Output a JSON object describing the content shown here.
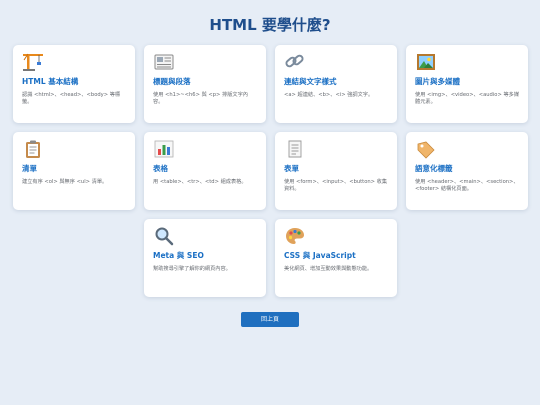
{
  "page": {
    "title": "HTML 要學什麼?"
  },
  "cards": [
    {
      "icon": "construction-crane-icon",
      "title": "HTML 基本結構",
      "desc": "認識 <html>、<head>、<body> 等標籤。"
    },
    {
      "icon": "newspaper-icon",
      "title": "標題與段落",
      "desc": "使用 <h1>~<h6> 與 <p> 排版文字內容。"
    },
    {
      "icon": "link-icon",
      "title": "連結與文字樣式",
      "desc": "<a> 超連結、<b>、<i> 強調文字。"
    },
    {
      "icon": "framed-picture-icon",
      "title": "圖片與多媒體",
      "desc": "使用 <img>、<video>、<audio> 等多媒體元素。"
    },
    {
      "icon": "clipboard-icon",
      "title": "清單",
      "desc": "建立有序 <ol> 與無序 <ul> 清單。"
    },
    {
      "icon": "bar-chart-icon",
      "title": "表格",
      "desc": "用 <table>、<tr>、<td> 組成表格。"
    },
    {
      "icon": "form-document-icon",
      "title": "表單",
      "desc": "使用 <form>、<input>、<button> 收集資料。"
    },
    {
      "icon": "tag-icon",
      "title": "語意化標籤",
      "desc": "使用 <header>、<main>、<section>、<footer> 結構化頁面。"
    },
    {
      "icon": "magnifying-glass-icon",
      "title": "Meta 與 SEO",
      "desc": "幫助搜尋引擎了解你的網頁內容。"
    },
    {
      "icon": "artist-palette-icon",
      "title": "CSS 與 JavaScript",
      "desc": "美化網頁、增加互動效果與動態功能。"
    }
  ],
  "back_button": {
    "label": "回上頁"
  },
  "colors": {
    "background": "#e6edf6",
    "title": "#1f4e8c",
    "card_title": "#1a6fc4",
    "button": "#1f6fbf"
  }
}
